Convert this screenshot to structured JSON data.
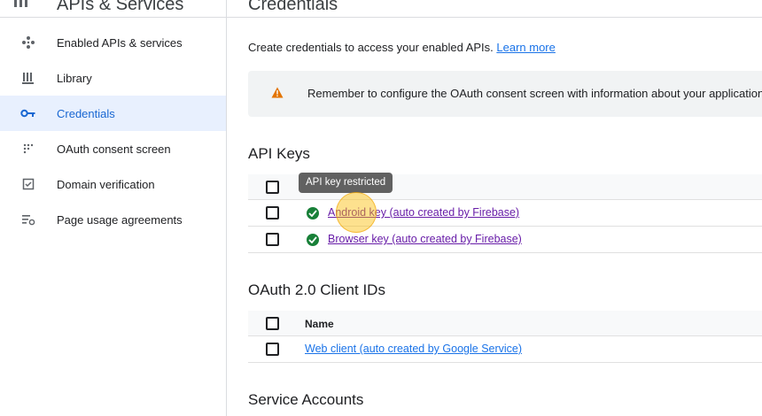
{
  "sidebar": {
    "title": "APIs & Services",
    "items": [
      {
        "label": "Enabled APIs & services",
        "icon": "diamond-arrows-icon"
      },
      {
        "label": "Library",
        "icon": "library-icon"
      },
      {
        "label": "Credentials",
        "icon": "key-icon",
        "active": true
      },
      {
        "label": "OAuth consent screen",
        "icon": "dots-grid-icon"
      },
      {
        "label": "Domain verification",
        "icon": "checkbox-square-icon"
      },
      {
        "label": "Page usage agreements",
        "icon": "settings-list-icon"
      }
    ]
  },
  "main": {
    "title": "Credentials",
    "intro_text": "Create credentials to access your enabled APIs.",
    "learn_more": "Learn more",
    "banner_text": "Remember to configure the OAuth consent screen with information about your application.",
    "api_keys": {
      "title": "API Keys",
      "tooltip": "API key restricted",
      "rows": [
        {
          "name": "Android key (auto created by Firebase)"
        },
        {
          "name": "Browser key (auto created by Firebase)"
        }
      ]
    },
    "oauth": {
      "title": "OAuth 2.0 Client IDs",
      "header_name": "Name",
      "rows": [
        {
          "name": "Web client (auto created by Google Service)"
        }
      ]
    },
    "service_accounts": {
      "title": "Service Accounts"
    }
  },
  "colors": {
    "active_bg": "#e8f0fe",
    "active_text": "#1967d2",
    "link_visited": "#681da8",
    "link": "#1a73e8",
    "check_green": "#188038",
    "warning": "#e37400"
  }
}
